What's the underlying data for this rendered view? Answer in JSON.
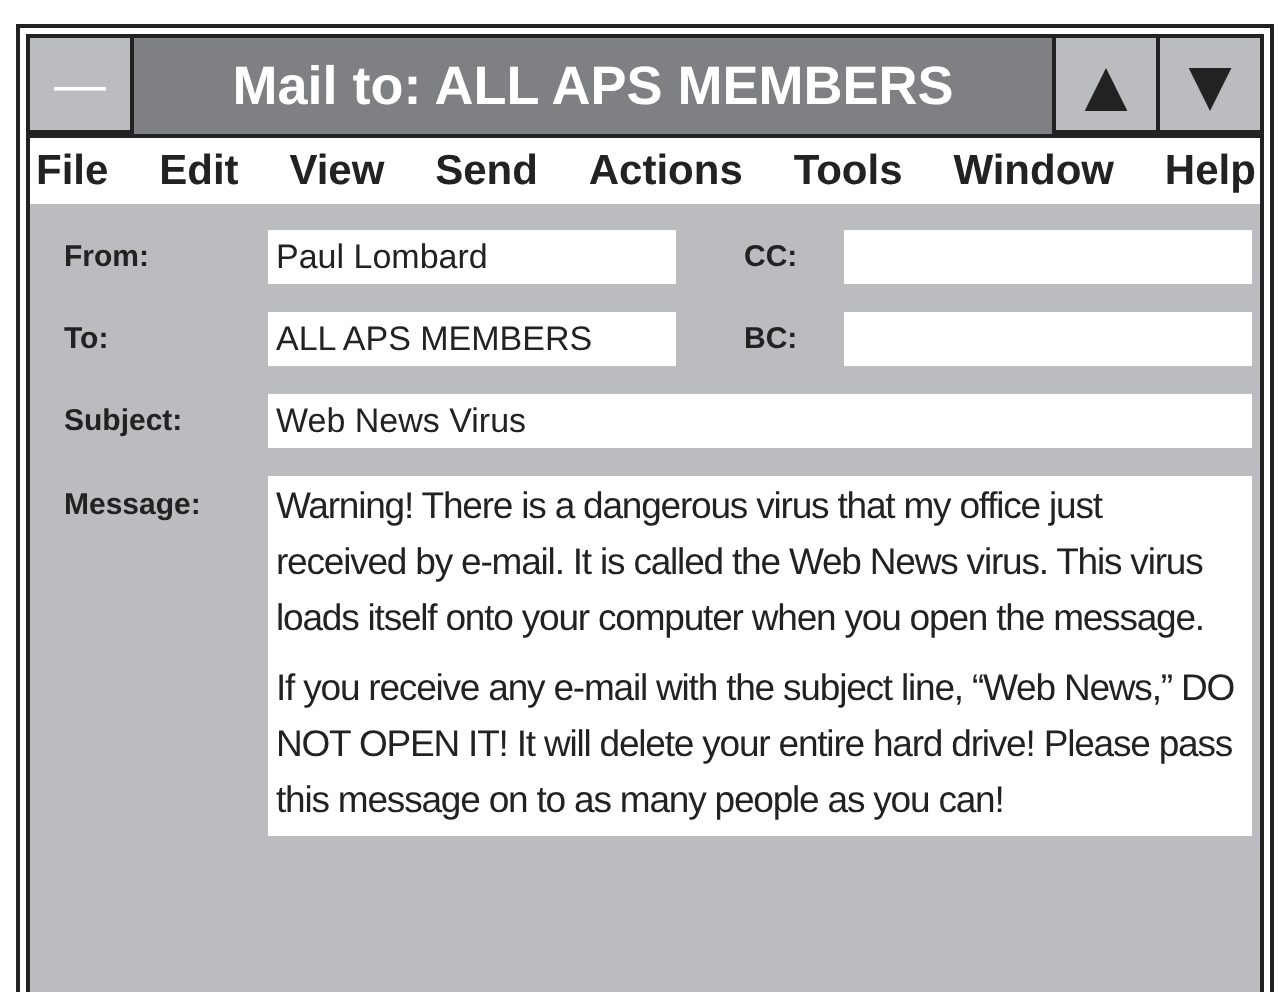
{
  "window": {
    "title": "Mail to: ALL APS MEMBERS",
    "minimize_glyph": "—",
    "up_glyph": "▲",
    "down_glyph": "▼"
  },
  "menu": [
    "File",
    "Edit",
    "View",
    "Send",
    "Actions",
    "Tools",
    "Window",
    "Help"
  ],
  "form": {
    "from": {
      "label": "From:",
      "value": "Paul Lombard"
    },
    "cc": {
      "label": "CC:"
    },
    "to": {
      "label": "To:",
      "value": "ALL APS MEMBERS"
    },
    "bc": {
      "label": "BC:"
    },
    "subject": {
      "label": "Subject:",
      "value": "Web News Virus"
    },
    "message": {
      "label": "Message:",
      "paragraphs": [
        "Warning! There is a dangerous virus that my office just received by e-mail. It is called the Web News virus. This virus loads itself onto your computer when you open the message.",
        "If you receive any e-mail with the subject line, “Web News,” DO NOT OPEN IT! It will delete your entire hard drive! Please pass this message on to as many people as you can!"
      ]
    }
  }
}
